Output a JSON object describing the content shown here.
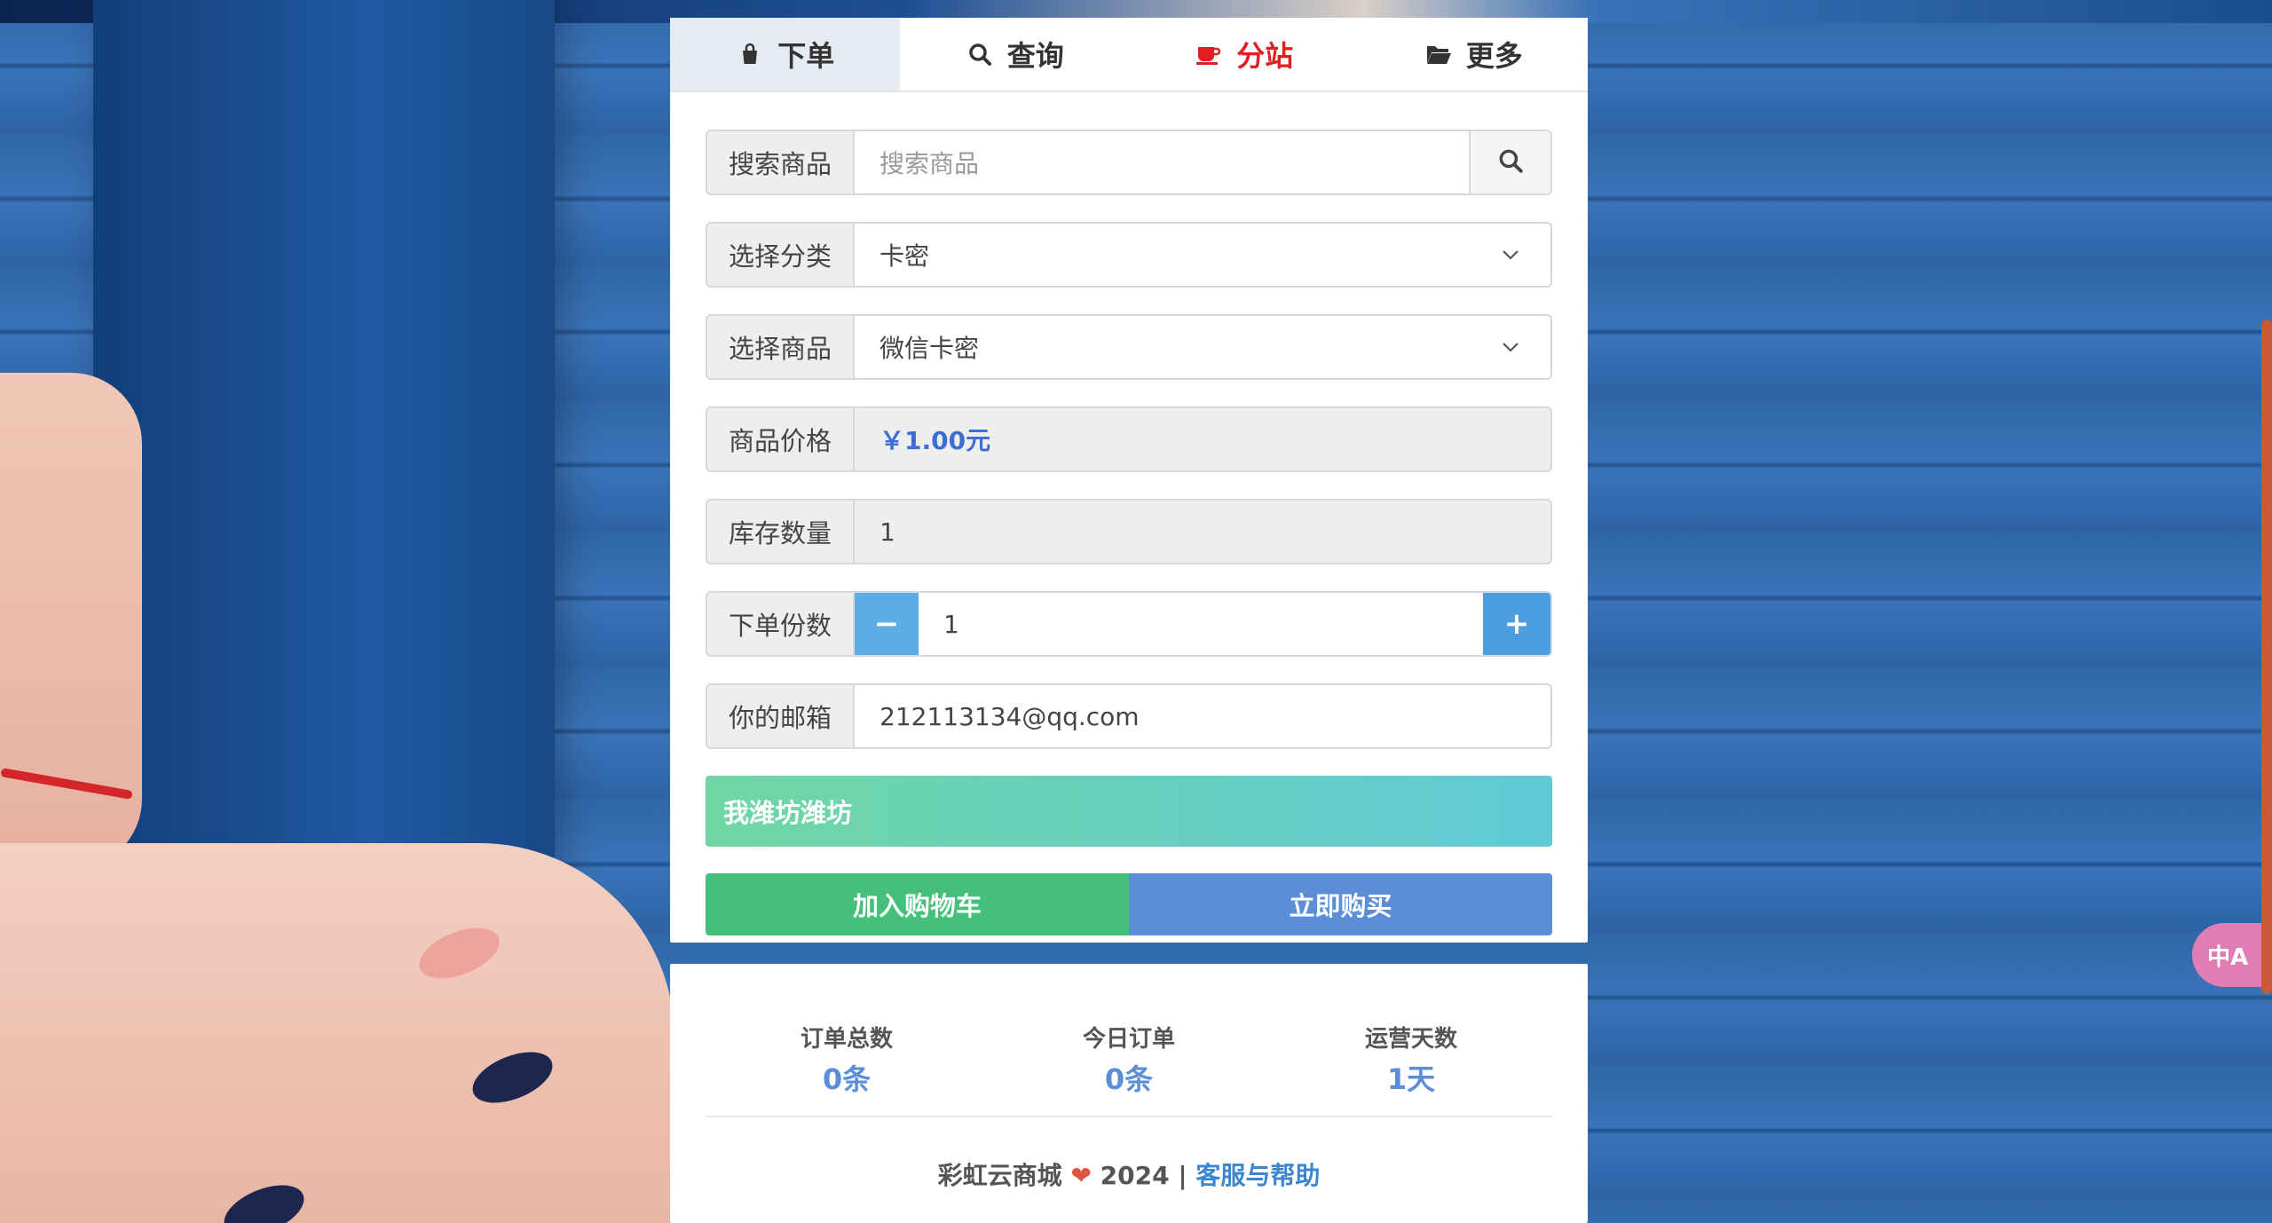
{
  "tabs": [
    {
      "label": "下单",
      "icon": "shopping-bag-icon",
      "active": true
    },
    {
      "label": "查询",
      "icon": "search-icon"
    },
    {
      "label": "分站",
      "icon": "coffee-cup-icon",
      "color": "#e02020"
    },
    {
      "label": "更多",
      "icon": "folder-open-icon"
    }
  ],
  "form": {
    "search": {
      "label": "搜索商品",
      "placeholder": "搜索商品"
    },
    "category": {
      "label": "选择分类",
      "value": "卡密"
    },
    "product": {
      "label": "选择商品",
      "value": "微信卡密"
    },
    "price": {
      "label": "商品价格",
      "value": "￥1.00元"
    },
    "stock": {
      "label": "库存数量",
      "value": "1"
    },
    "quantity": {
      "label": "下单份数",
      "value": "1",
      "minus": "−",
      "plus": "+"
    },
    "email": {
      "label": "你的邮箱",
      "value": "212113134@qq.com"
    }
  },
  "notice": "我潍坊潍坊",
  "actions": {
    "cart": "加入购物车",
    "buy": "立即购买"
  },
  "stats": [
    {
      "label": "订单总数",
      "value": "0条"
    },
    {
      "label": "今日订单",
      "value": "0条"
    },
    {
      "label": "运营天数",
      "value": "1天"
    }
  ],
  "footer": {
    "brand": "彩虹云商城",
    "heart": "❤",
    "year": "2024 |",
    "link": "客服与帮助"
  },
  "translate_button": "中A",
  "colors": {
    "accent": "#5b8ed6",
    "cart": "#44c07b",
    "stepper": "#5bade3",
    "highlight_tab": "#e02020"
  }
}
